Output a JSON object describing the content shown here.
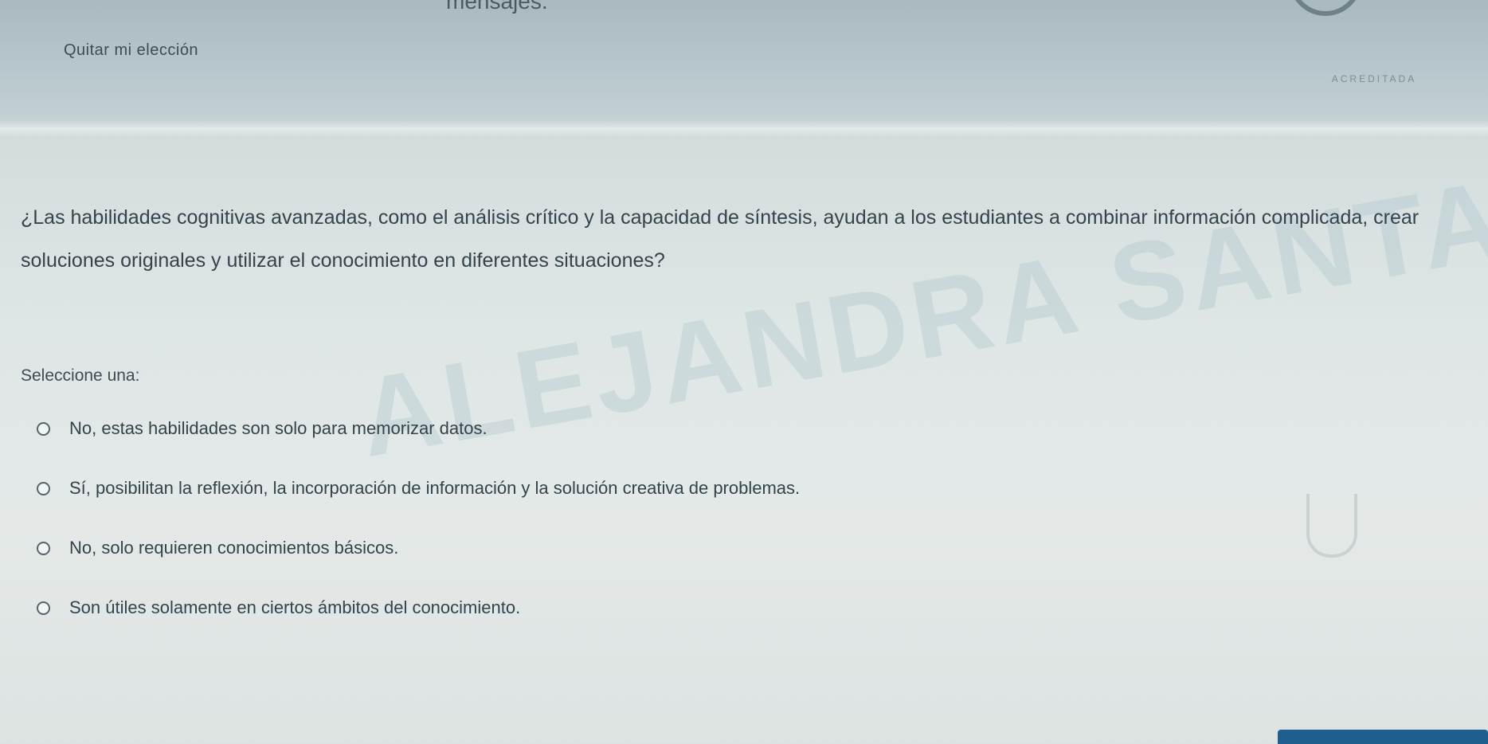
{
  "header": {
    "partial_text": "mensajes.",
    "clear_choice_label": "Quitar mi elección"
  },
  "question": {
    "text": "¿Las habilidades cognitivas avanzadas, como el análisis crítico y la capacidad de síntesis, ayudan a los estudiantes a combinar información complicada, crear soluciones originales y utilizar el conocimiento en diferentes situaciones?",
    "select_label": "Seleccione una:",
    "options": [
      {
        "label": "No, estas habilidades son solo para memorizar datos."
      },
      {
        "label": "Sí, posibilitan la reflexión, la incorporación de información y la solución creativa de problemas."
      },
      {
        "label": "No, solo requieren conocimientos básicos."
      },
      {
        "label": "Son útiles solamente en ciertos ámbitos del conocimiento."
      }
    ]
  },
  "watermark": "ALEJANDRA SANTANA",
  "logo": {
    "accreditation_text": "ACREDITADA"
  },
  "colors": {
    "accent": "#1f5f8d",
    "text": "#34444c",
    "background": "#e0e6e6"
  }
}
